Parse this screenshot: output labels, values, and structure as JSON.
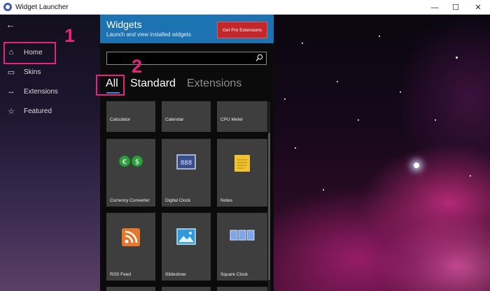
{
  "window": {
    "title": "Widget Launcher",
    "minimize": "—",
    "maximize": "☐",
    "close": "✕"
  },
  "sidebar": {
    "back": "←",
    "items": [
      {
        "label": "Home",
        "icon": "home-icon",
        "glyph": "⌂"
      },
      {
        "label": "Skins",
        "icon": "skins-icon",
        "glyph": "▭"
      },
      {
        "label": "Extensions",
        "icon": "extensions-icon",
        "glyph": "↔"
      },
      {
        "label": "Featured",
        "icon": "star-icon",
        "glyph": "☆"
      }
    ]
  },
  "annotations": {
    "one": "1",
    "two": "2"
  },
  "panel": {
    "title": "Widgets",
    "subtitle": "Launch and view installed widgets",
    "pro_button": "Get Pro Extensions",
    "search": {
      "value": "",
      "placeholder": ""
    },
    "tabs": [
      {
        "label": "All",
        "selected": true
      },
      {
        "label": "Standard",
        "selected": false
      },
      {
        "label": "Extensions",
        "selected": false
      }
    ],
    "tiles_row1": [
      "Calculator",
      "Calendar",
      "CPU Meter"
    ],
    "tiles_row2": [
      "Currency Converter",
      "Digital Clock",
      "Notes"
    ],
    "tiles_row3": [
      "RSS Feed",
      "Slideshow",
      "Square Clock"
    ],
    "currency_symbols": [
      "€",
      "$"
    ],
    "digital_clock_text": "888"
  },
  "colors": {
    "accent": "#1d73b2",
    "pro_button": "#c3262b",
    "annotation": "#e6247b",
    "tab_underline": "#4a7fe0"
  }
}
